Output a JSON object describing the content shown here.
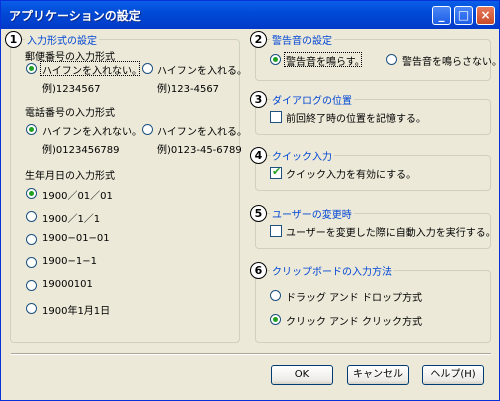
{
  "window": {
    "title": "アプリケーションの設定",
    "minimize_glyph": "_",
    "maximize_glyph": "□",
    "close_glyph": "×"
  },
  "groups": {
    "input_format": {
      "number": "1",
      "legend": "入力形式の設定",
      "postal": {
        "label": "郵便番号の入力形式",
        "options": [
          {
            "label": "ハイフンを入れない。",
            "example": "例)1234567",
            "selected": true
          },
          {
            "label": "ハイフンを入れる。",
            "example": "例)123-4567",
            "selected": false
          }
        ]
      },
      "phone": {
        "label": "電話番号の入力形式",
        "options": [
          {
            "label": "ハイフンを入れない。",
            "example": "例)0123456789",
            "selected": true
          },
          {
            "label": "ハイフンを入れる。",
            "example": "例)0123-45-6789",
            "selected": false
          }
        ]
      },
      "birthdate": {
        "label": "生年月日の入力形式",
        "options": [
          {
            "label": "1900／01／01",
            "selected": true
          },
          {
            "label": "1900／1／1",
            "selected": false
          },
          {
            "label": "1900−01−01",
            "selected": false
          },
          {
            "label": "1900−1−1",
            "selected": false
          },
          {
            "label": "19000101",
            "selected": false
          },
          {
            "label": "1900年1月1日",
            "selected": false
          }
        ]
      }
    },
    "warning_sound": {
      "number": "2",
      "legend": "警告音の設定",
      "options": [
        {
          "label": "警告音を鳴らす。",
          "selected": true
        },
        {
          "label": "警告音を鳴らさない。",
          "selected": false
        }
      ]
    },
    "dialog_position": {
      "number": "3",
      "legend": "ダイアログの位置",
      "checkbox": {
        "label": "前回終了時の位置を記憶する。",
        "checked": false
      }
    },
    "quick_input": {
      "number": "4",
      "legend": "クイック入力",
      "checkbox": {
        "label": "クイック入力を有効にする。",
        "checked": true
      }
    },
    "user_change": {
      "number": "5",
      "legend": "ユーザーの変更時",
      "checkbox": {
        "label": "ユーザーを変更した際に自動入力を実行する。",
        "checked": false
      }
    },
    "clipboard": {
      "number": "6",
      "legend": "クリップボードの入力方法",
      "options": [
        {
          "label": "ドラッグ アンド ドロップ方式",
          "selected": false
        },
        {
          "label": "クリック アンド クリック方式",
          "selected": true
        }
      ]
    }
  },
  "buttons": {
    "ok": "OK",
    "cancel": "キャンセル",
    "help": "ヘルプ(H)"
  }
}
